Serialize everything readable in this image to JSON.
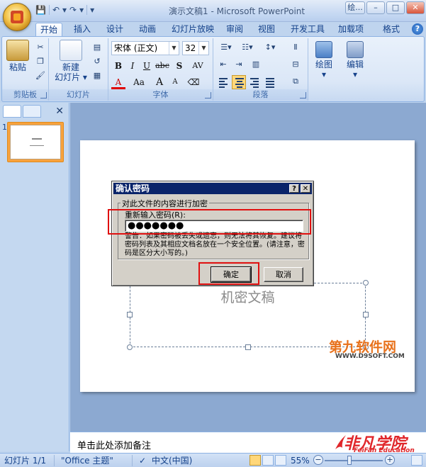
{
  "window": {
    "title": "演示文稿1 - Microsoft PowerPoint",
    "label_button": "绘...",
    "minimize": "–",
    "maximize": "□",
    "close": "✕"
  },
  "qat": {
    "save": "💾",
    "undo": "↶",
    "dropdown1": "▾",
    "redo": "↷",
    "dropdown2": "▾",
    "customize": "▾"
  },
  "tabs": [
    "开始",
    "插入",
    "设计",
    "动画",
    "幻灯片放映",
    "审阅",
    "视图",
    "开发工具",
    "加载项",
    "格式"
  ],
  "help": "?",
  "ribbon": {
    "clipboard": {
      "label": "剪贴板",
      "paste": "粘贴"
    },
    "slides": {
      "label": "幻灯片",
      "new_slide_1": "新建",
      "new_slide_2": "幻灯片 ▾"
    },
    "font": {
      "label": "字体",
      "font_name": "宋体 (正文)",
      "font_size": "32",
      "bold": "B",
      "italic": "I",
      "underline": "U",
      "strikethrough": "abc",
      "shadow": "S",
      "spacing": "AV",
      "font_color": "A",
      "change_case": "Aa",
      "grow": "A",
      "shrink": "A"
    },
    "paragraph": {
      "label": "段落"
    },
    "drawing": {
      "label": "绘图"
    },
    "editing": {
      "label": "编辑"
    }
  },
  "left_panel": {
    "slide_number": "1",
    "close": "✕"
  },
  "slide": {
    "subtitle_placeholder": "机密文稿"
  },
  "watermark": {
    "main": "第九软件网",
    "url": "WWW.D9SOFT.COM"
  },
  "notes": {
    "placeholder": "单击此处添加备注"
  },
  "logo2": {
    "main": "非凡学院",
    "sub": "FeiFan Education"
  },
  "status": {
    "slide": "幻灯片 1/1",
    "theme": "\"Office 主题\"",
    "language": "中文(中国)",
    "zoom": "55%",
    "zoom_minus": "−",
    "zoom_plus": "+"
  },
  "dialog": {
    "title": "确认密码",
    "help_btn": "?",
    "close_btn": "✕",
    "group_label": "对此文件的内容进行加密",
    "field_label": "重新输入密码(R):",
    "password_value": "●●●●●●●",
    "warning": "警告：如果密码被丢失或遗忘，则无法将其恢复。建议将密码列表及其相应文档名放在一个安全位置。(请注意，密码是区分大小写的。)",
    "ok": "确定",
    "cancel": "取消"
  },
  "colors": {
    "highlight": "#e01010",
    "dialog_title_bg": "#0a246a",
    "watermark": "#e8721c",
    "logo_red": "#e0262a"
  }
}
